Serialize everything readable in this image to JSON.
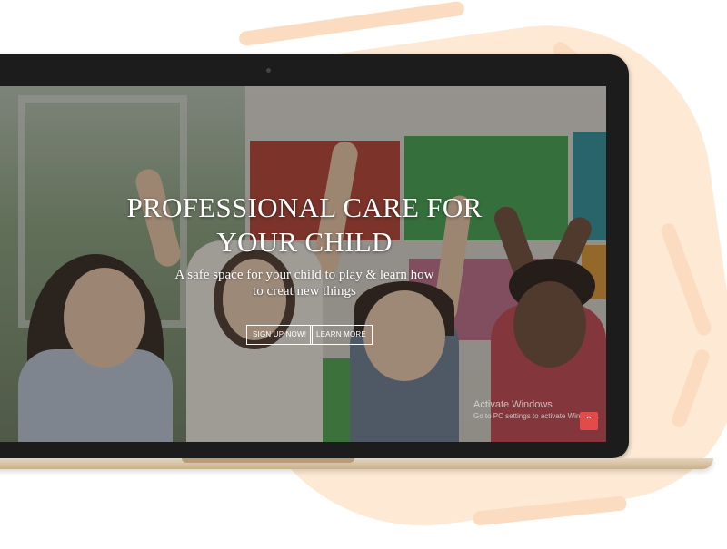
{
  "hero": {
    "title_line1": "PROFESSIONAL CARE FOR",
    "title_line2": "YOUR CHILD",
    "subtitle_line1": "A safe space for your child to play & learn how",
    "subtitle_line2": "to creat new things",
    "buttons": {
      "signup_label": "SIGN UP NOW!",
      "learn_label": "LEARN MORE"
    }
  },
  "windows_watermark": {
    "title": "Activate Windows",
    "subtitle": "Go to PC settings to activate Windows."
  },
  "scroll_top": {
    "icon": "chevron-up-icon",
    "glyph": "⌃"
  },
  "colors": {
    "background_accent": "#fde9d4",
    "laptop_bezel": "#1c1c1c",
    "laptop_base": "#d8c2a2",
    "scroll_button": "#e34b4b",
    "hero_text": "#ffffff"
  }
}
